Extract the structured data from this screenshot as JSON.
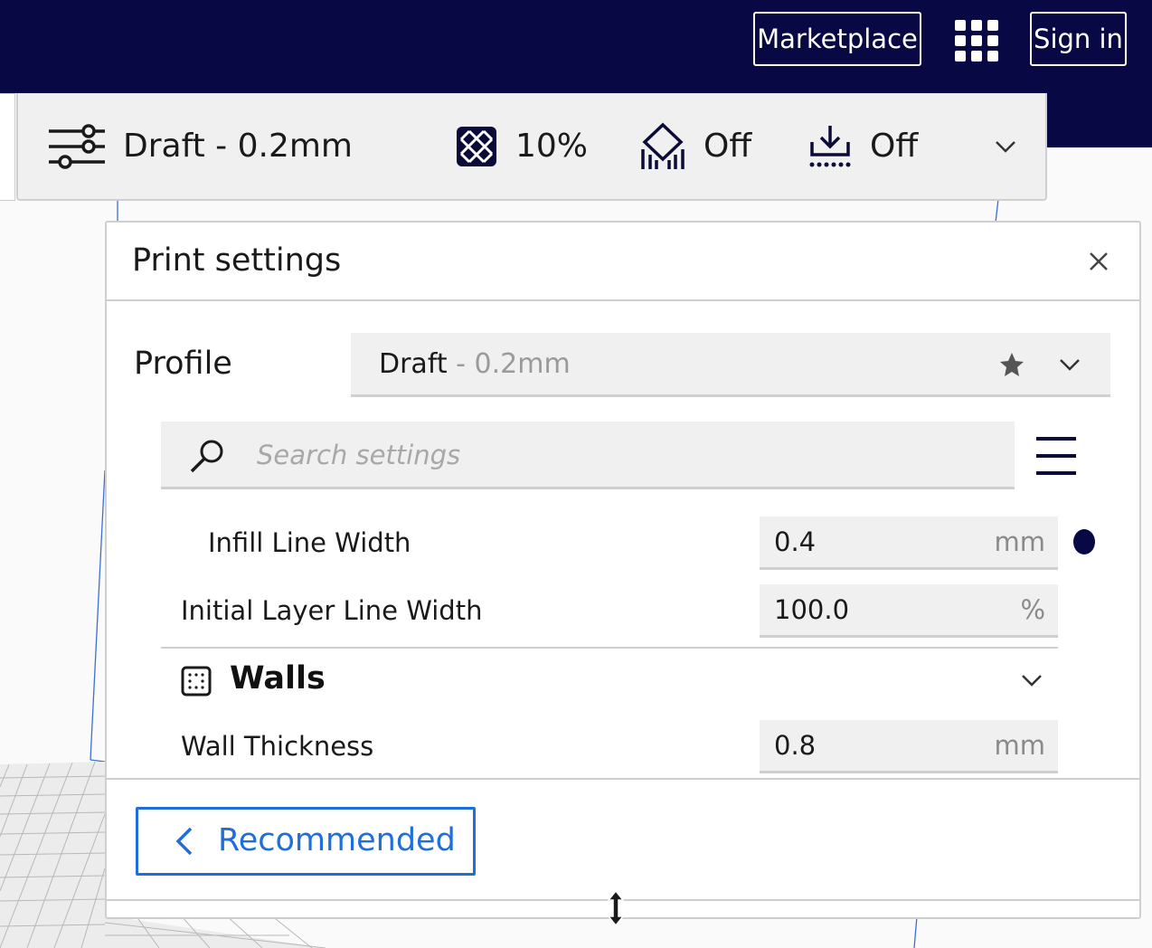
{
  "header": {
    "marketplace_label": "Marketplace",
    "apps_icon": "grid-apps-icon",
    "signin_label": "Sign in"
  },
  "toolbar": {
    "profile_icon": "sliders-icon",
    "profile_label": "Draft - 0.2mm",
    "infill_icon": "infill-icon",
    "infill_value": "10%",
    "support_icon": "support-icon",
    "support_value": "Off",
    "adhesion_icon": "adhesion-icon",
    "adhesion_value": "Off",
    "expand_icon": "chevron-down-icon"
  },
  "panel": {
    "title": "Print settings",
    "close_icon": "close-icon",
    "profile": {
      "label": "Profile",
      "name": "Draft",
      "sub": " - 0.2mm",
      "star_icon": "star-icon",
      "chevron_icon": "chevron-down-icon"
    },
    "search": {
      "placeholder": "Search settings",
      "value": "",
      "icon": "search-icon",
      "menu_icon": "hamburger-menu-icon"
    },
    "settings": [
      {
        "label": "Infill Line Width",
        "value": "0.4",
        "unit": "mm",
        "modified": true
      },
      {
        "label": "Initial Layer Line Width",
        "value": "100.0",
        "unit": "%"
      }
    ],
    "category": {
      "title": "Walls",
      "icon": "walls-icon",
      "chevron_icon": "chevron-down-icon"
    },
    "wall_settings": [
      {
        "label": "Wall Thickness",
        "value": "0.8",
        "unit": "mm"
      }
    ],
    "recommended_button": "Recommended",
    "resize_icon": "resize-vertical-icon"
  },
  "colors": {
    "header_bg": "#080844",
    "accent_blue": "#1f6fd9",
    "field_bg": "#f0f0f0"
  }
}
